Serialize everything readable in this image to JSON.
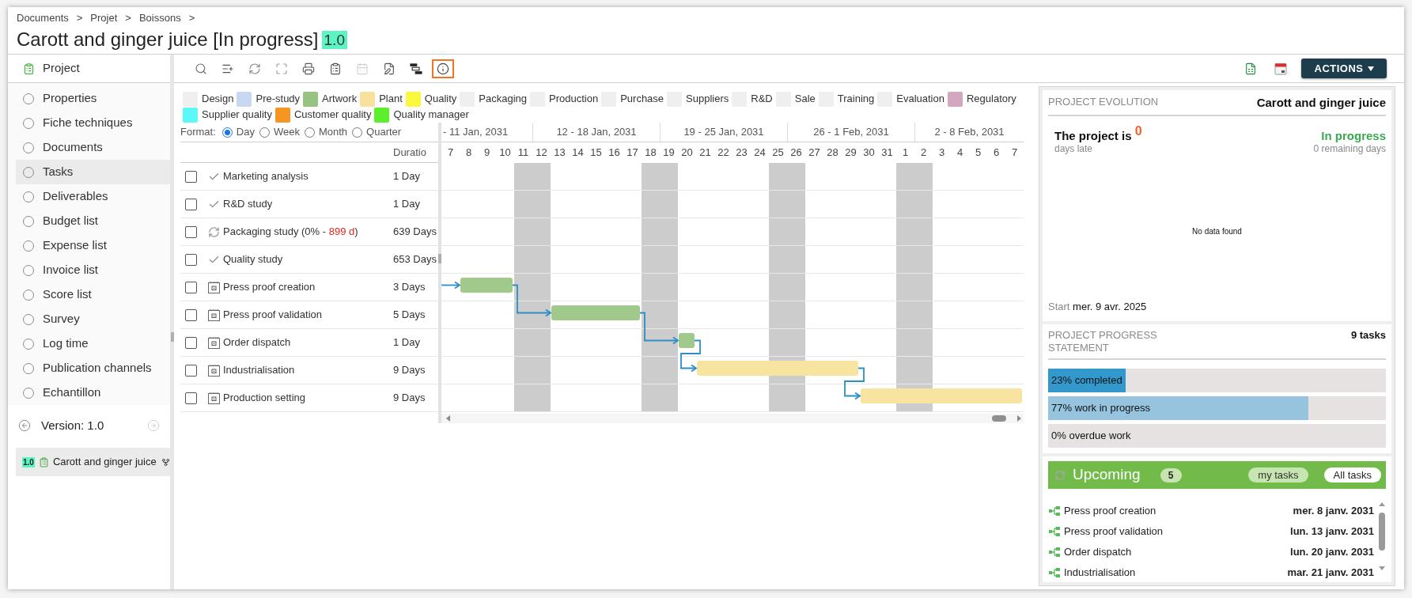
{
  "breadcrumb": [
    {
      "label": "Documents",
      "separator": ">"
    },
    {
      "label": "Projet",
      "separator": ">"
    },
    {
      "label": "Boissons",
      "separator": ">"
    }
  ],
  "title": {
    "text": "Carott and ginger juice [In progress]",
    "version": "1.0"
  },
  "sidebar": {
    "header": "Project",
    "items": [
      {
        "label": "Properties",
        "selected": false
      },
      {
        "label": "Fiche techniques",
        "selected": false
      },
      {
        "label": "Documents",
        "selected": false
      },
      {
        "label": "Tasks",
        "selected": true
      },
      {
        "label": "Deliverables",
        "selected": false
      },
      {
        "label": "Budget list",
        "selected": false
      },
      {
        "label": "Expense list",
        "selected": false
      },
      {
        "label": "Invoice list",
        "selected": false
      },
      {
        "label": "Score list",
        "selected": false
      },
      {
        "label": "Survey",
        "selected": false
      },
      {
        "label": "Log time",
        "selected": false
      },
      {
        "label": "Publication channels",
        "selected": false
      },
      {
        "label": "Echantillon",
        "selected": false
      }
    ],
    "version": {
      "label": "Version: 1.0",
      "previous_disabled": false,
      "next_disabled": true
    },
    "versions": [
      {
        "badge": "1.0",
        "label": "Carott and ginger juice",
        "selected": true
      }
    ]
  },
  "toolbar": {
    "tools": [
      {
        "kind": "search",
        "selected": false,
        "disabled": false
      },
      {
        "kind": "add_row",
        "selected": false,
        "disabled": false
      },
      {
        "kind": "refresh",
        "selected": false,
        "disabled": false
      },
      {
        "kind": "expand",
        "selected": false,
        "disabled": false
      },
      {
        "kind": "print",
        "selected": false,
        "disabled": false
      },
      {
        "kind": "clipboard",
        "selected": false,
        "disabled": false
      },
      {
        "kind": "calendar",
        "selected": false,
        "disabled": true
      },
      {
        "kind": "edit",
        "selected": false,
        "disabled": false
      },
      {
        "kind": "gantt",
        "selected": false,
        "disabled": false
      },
      {
        "kind": "info",
        "selected": true,
        "disabled": false
      }
    ],
    "actions": {
      "label": "ACTIONS"
    }
  },
  "legend": [
    {
      "label": "Design",
      "color": "#efefef"
    },
    {
      "label": "Pre-study",
      "color": "#c9d8f2"
    },
    {
      "label": "Artwork",
      "color": "#98c282"
    },
    {
      "label": "Plant",
      "color": "#f8e09d"
    },
    {
      "label": "Quality",
      "color": "#f9f83c"
    },
    {
      "label": "Packaging",
      "color": "#efefef"
    },
    {
      "label": "Production",
      "color": "#efefef"
    },
    {
      "label": "Purchase",
      "color": "#efefef"
    },
    {
      "label": "Suppliers",
      "color": "#efefef"
    },
    {
      "label": "R&D",
      "color": "#efefef"
    },
    {
      "label": "Sale",
      "color": "#efefef"
    },
    {
      "label": "Training",
      "color": "#efefef"
    },
    {
      "label": "Evaluation",
      "color": "#efefef"
    },
    {
      "label": "Regulatory",
      "color": "#d3a7bf"
    },
    {
      "label": "Supplier quality",
      "color": "#5cf8f8"
    },
    {
      "label": "Customer quality",
      "color": "#f59522"
    },
    {
      "label": "Quality manager",
      "color": "#5cf02c"
    }
  ],
  "gantt": {
    "format": {
      "label": "Format:",
      "options": [
        {
          "label": "Day",
          "selected": true
        },
        {
          "label": "Week",
          "selected": false
        },
        {
          "label": "Month",
          "selected": false
        },
        {
          "label": "Quarter",
          "selected": false
        }
      ]
    },
    "duration_header": "Duratio",
    "weeks": [
      {
        "label": "- 11 Jan, 2031",
        "days": [
          {
            "label": "7",
            "weekend": false
          },
          {
            "label": "8",
            "weekend": false
          },
          {
            "label": "9",
            "weekend": false
          },
          {
            "label": "10",
            "weekend": false
          },
          {
            "label": "11",
            "weekend": true
          }
        ]
      },
      {
        "label": "12 - 18 Jan, 2031",
        "days": [
          {
            "label": "12",
            "weekend": true
          },
          {
            "label": "13",
            "weekend": false
          },
          {
            "label": "14",
            "weekend": false
          },
          {
            "label": "15",
            "weekend": false
          },
          {
            "label": "16",
            "weekend": false
          },
          {
            "label": "17",
            "weekend": false
          },
          {
            "label": "18",
            "weekend": true
          }
        ]
      },
      {
        "label": "19 - 25 Jan, 2031",
        "days": [
          {
            "label": "19",
            "weekend": true
          },
          {
            "label": "20",
            "weekend": false
          },
          {
            "label": "21",
            "weekend": false
          },
          {
            "label": "22",
            "weekend": false
          },
          {
            "label": "23",
            "weekend": false
          },
          {
            "label": "24",
            "weekend": false
          },
          {
            "label": "25",
            "weekend": true
          }
        ]
      },
      {
        "label": "26 - 1 Feb, 2031",
        "days": [
          {
            "label": "26",
            "weekend": true
          },
          {
            "label": "27",
            "weekend": false
          },
          {
            "label": "28",
            "weekend": false
          },
          {
            "label": "29",
            "weekend": false
          },
          {
            "label": "30",
            "weekend": false
          },
          {
            "label": "31",
            "weekend": false
          },
          {
            "label": "1",
            "weekend": true
          }
        ]
      },
      {
        "label": "2 - 8 Feb, 2031",
        "days": [
          {
            "label": "2",
            "weekend": true
          },
          {
            "label": "3",
            "weekend": false
          },
          {
            "label": "4",
            "weekend": false
          },
          {
            "label": "5",
            "weekend": false
          },
          {
            "label": "6",
            "weekend": false
          },
          {
            "label": "7",
            "weekend": false
          }
        ]
      }
    ],
    "tasks": [
      {
        "checked": false,
        "kind": "done",
        "name": "Marketing analysis",
        "duration": "1 Day"
      },
      {
        "checked": false,
        "kind": "done",
        "name": "R&D study",
        "duration": "1 Day"
      },
      {
        "checked": false,
        "kind": "in_progress",
        "name": "Packaging study (0% - ",
        "late": "899 d",
        "name_end": ")",
        "duration": "639 Days"
      },
      {
        "checked": false,
        "kind": "done",
        "name": "Quality study",
        "duration": "653 Days"
      },
      {
        "checked": false,
        "kind": "planned",
        "name": "Press proof creation",
        "duration": "3 Days",
        "color": "#a1c98b",
        "linked": true
      },
      {
        "checked": false,
        "kind": "planned",
        "name": "Press proof validation",
        "duration": "5 Days",
        "color": "#a1c98b",
        "linked": true
      },
      {
        "checked": false,
        "kind": "planned",
        "name": "Order dispatch",
        "duration": "1 Day",
        "color": "#a1c98b",
        "linked": true
      },
      {
        "checked": false,
        "kind": "planned",
        "name": "Industrialisation",
        "duration": "9 Days",
        "color": "#f8e4a1",
        "linked": true
      },
      {
        "checked": false,
        "kind": "planned",
        "name": "Production setting",
        "duration": "9 Days",
        "color": "#f8e4a1",
        "linked": true
      }
    ]
  },
  "evolution": {
    "title": "PROJECT EVOLUTION",
    "project": "Carott and ginger juice",
    "late_label": "The project is",
    "late_value": "0",
    "late_caption": "days late",
    "status": "In progress",
    "remaining": "0 remaining days",
    "empty_message": "No data found",
    "start_label": "Start",
    "start_date": "mer. 9 avr. 2025"
  },
  "progress": {
    "title": "PROJECT PROGRESS STATEMENT",
    "count": "9 tasks",
    "bars": [
      {
        "label": "23% completed",
        "level": 0.23,
        "color": "#3399cc"
      },
      {
        "label": "77% work in progress",
        "level": 0.77,
        "color": "#96c4de"
      },
      {
        "label": "0% overdue work"
      }
    ]
  },
  "upcoming": {
    "title": "Upcoming",
    "count": "5",
    "filters": [
      {
        "label": "my tasks",
        "selected": false
      },
      {
        "label": "All tasks",
        "selected": true
      }
    ],
    "items": [
      {
        "name": "Press proof creation",
        "date": "mer. 8 janv. 2031"
      },
      {
        "name": "Press proof validation",
        "date": "lun. 13 janv. 2031"
      },
      {
        "name": "Order dispatch",
        "date": "lun. 20 janv. 2031"
      },
      {
        "name": "Industrialisation",
        "date": "mar. 21 janv. 2031"
      }
    ]
  }
}
